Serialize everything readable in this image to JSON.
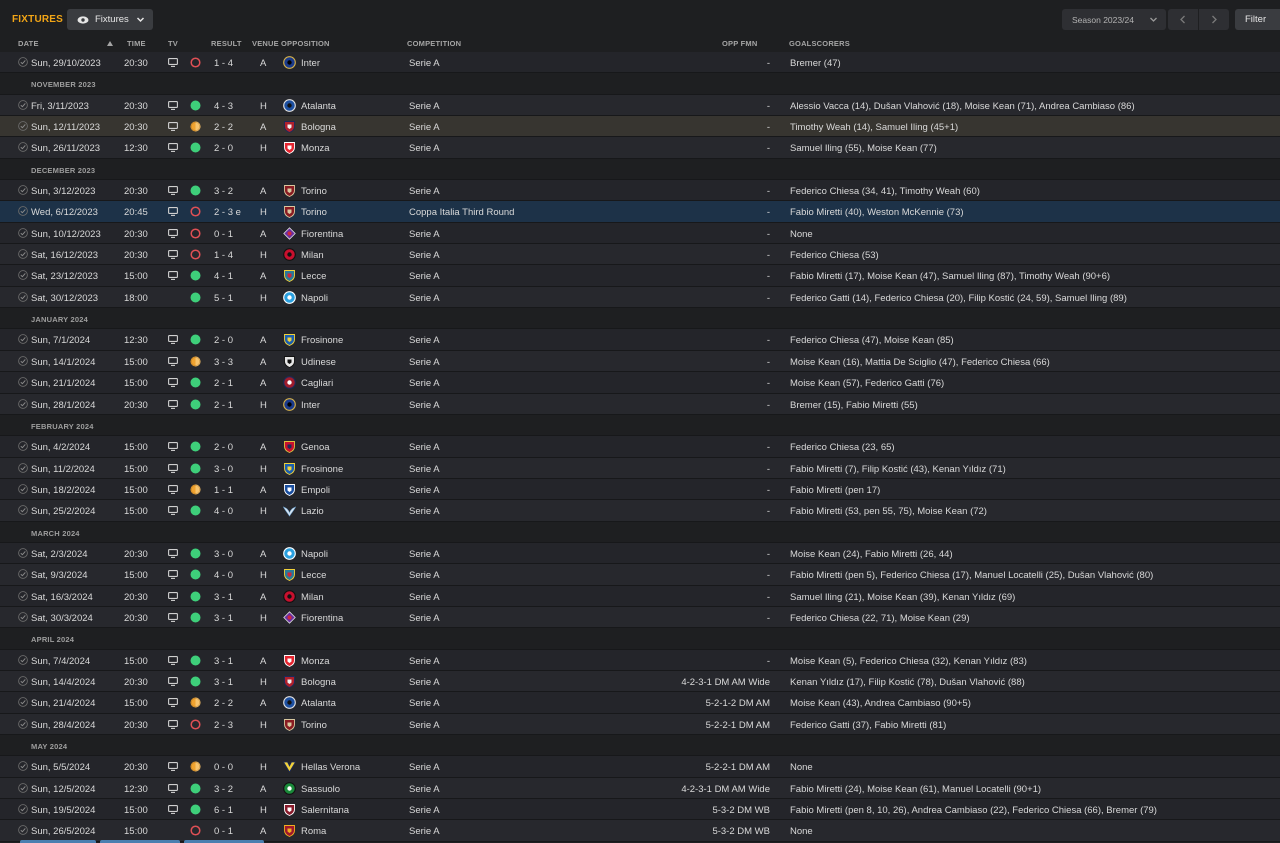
{
  "header": {
    "title": "FIXTURES",
    "view_label": "Fixtures",
    "season_label": "Season 2023/24",
    "filter_label": "Filter"
  },
  "columns": {
    "date": "DATE",
    "time": "TIME",
    "tv": "TV",
    "result": "RESULT",
    "venue": "VENUE",
    "opposition": "OPPOSITION",
    "competition": "COMPETITION",
    "opp_fmn": "OPP FMN",
    "goalscorers": "GOALSCORERS"
  },
  "colors": {
    "win": "#3ecf7a",
    "draw": "#f0a330",
    "loss": "#e05055",
    "accent": "#f2a516"
  },
  "rows": [
    {
      "type": "match",
      "date": "Sun, 29/10/2023",
      "time": "20:30",
      "tv": true,
      "outcome": "loss",
      "score": "1 - 4",
      "venue": "A",
      "opp": "Inter",
      "crest": "inter",
      "comp": "Serie A",
      "fmn": "-",
      "scorers": "Bremer (47)"
    },
    {
      "type": "section",
      "label": "NOVEMBER 2023"
    },
    {
      "type": "match",
      "date": "Fri, 3/11/2023",
      "time": "20:30",
      "tv": true,
      "outcome": "win",
      "score": "4 - 3",
      "venue": "H",
      "opp": "Atalanta",
      "crest": "atalanta",
      "comp": "Serie A",
      "fmn": "-",
      "scorers": "Alessio Vacca (14), Dušan Vlahović (18), Moise Kean (71), Andrea Cambiaso (86)"
    },
    {
      "type": "match",
      "date": "Sun, 12/11/2023",
      "time": "20:30",
      "tv": true,
      "outcome": "draw",
      "score": "2 - 2",
      "venue": "A",
      "opp": "Bologna",
      "crest": "bologna",
      "comp": "Serie A",
      "fmn": "-",
      "scorers": "Timothy Weah (14), Samuel Iling (45+1)",
      "state": "highlight"
    },
    {
      "type": "match",
      "date": "Sun, 26/11/2023",
      "time": "12:30",
      "tv": true,
      "outcome": "win",
      "score": "2 - 0",
      "venue": "H",
      "opp": "Monza",
      "crest": "monza",
      "comp": "Serie A",
      "fmn": "-",
      "scorers": "Samuel Iling (55), Moise Kean (77)"
    },
    {
      "type": "section",
      "label": "DECEMBER 2023"
    },
    {
      "type": "match",
      "date": "Sun, 3/12/2023",
      "time": "20:30",
      "tv": true,
      "outcome": "win",
      "score": "3 - 2",
      "venue": "A",
      "opp": "Torino",
      "crest": "torino",
      "comp": "Serie A",
      "fmn": "-",
      "scorers": "Federico Chiesa (34, 41), Timothy Weah (60)"
    },
    {
      "type": "match",
      "date": "Wed, 6/12/2023",
      "time": "20:45",
      "tv": true,
      "outcome": "loss",
      "score": "2 - 3 e",
      "venue": "H",
      "opp": "Torino",
      "crest": "torino",
      "comp": "Coppa Italia Third Round",
      "fmn": "-",
      "scorers": "Fabio Miretti (40), Weston McKennie (73)",
      "state": "selected"
    },
    {
      "type": "match",
      "date": "Sun, 10/12/2023",
      "time": "20:30",
      "tv": true,
      "outcome": "loss",
      "score": "0 - 1",
      "venue": "A",
      "opp": "Fiorentina",
      "crest": "fiorentina",
      "comp": "Serie A",
      "fmn": "-",
      "scorers": "None"
    },
    {
      "type": "match",
      "date": "Sat, 16/12/2023",
      "time": "20:30",
      "tv": true,
      "outcome": "loss",
      "score": "1 - 4",
      "venue": "H",
      "opp": "Milan",
      "crest": "milan",
      "comp": "Serie A",
      "fmn": "-",
      "scorers": "Federico Chiesa (53)"
    },
    {
      "type": "match",
      "date": "Sat, 23/12/2023",
      "time": "15:00",
      "tv": true,
      "outcome": "win",
      "score": "4 - 1",
      "venue": "A",
      "opp": "Lecce",
      "crest": "lecce",
      "comp": "Serie A",
      "fmn": "-",
      "scorers": "Fabio Miretti (17), Moise Kean (47), Samuel Iling (87), Timothy Weah (90+6)"
    },
    {
      "type": "match",
      "date": "Sat, 30/12/2023",
      "time": "18:00",
      "tv": false,
      "outcome": "win",
      "score": "5 - 1",
      "venue": "H",
      "opp": "Napoli",
      "crest": "napoli",
      "comp": "Serie A",
      "fmn": "-",
      "scorers": "Federico Gatti (14), Federico Chiesa (20), Filip Kostić (24, 59), Samuel Iling (89)"
    },
    {
      "type": "section",
      "label": "JANUARY 2024"
    },
    {
      "type": "match",
      "date": "Sun, 7/1/2024",
      "time": "12:30",
      "tv": true,
      "outcome": "win",
      "score": "2 - 0",
      "venue": "A",
      "opp": "Frosinone",
      "crest": "frosinone",
      "comp": "Serie A",
      "fmn": "-",
      "scorers": "Federico Chiesa (47), Moise Kean (85)"
    },
    {
      "type": "match",
      "date": "Sun, 14/1/2024",
      "time": "15:00",
      "tv": true,
      "outcome": "draw",
      "score": "3 - 3",
      "venue": "A",
      "opp": "Udinese",
      "crest": "udinese",
      "comp": "Serie A",
      "fmn": "-",
      "scorers": "Moise Kean (16), Mattia De Sciglio (47), Federico Chiesa (66)"
    },
    {
      "type": "match",
      "date": "Sun, 21/1/2024",
      "time": "15:00",
      "tv": true,
      "outcome": "win",
      "score": "2 - 1",
      "venue": "A",
      "opp": "Cagliari",
      "crest": "cagliari",
      "comp": "Serie A",
      "fmn": "-",
      "scorers": "Moise Kean (57), Federico Gatti (76)"
    },
    {
      "type": "match",
      "date": "Sun, 28/1/2024",
      "time": "20:30",
      "tv": true,
      "outcome": "win",
      "score": "2 - 1",
      "venue": "H",
      "opp": "Inter",
      "crest": "inter",
      "comp": "Serie A",
      "fmn": "-",
      "scorers": "Bremer (15), Fabio Miretti (55)"
    },
    {
      "type": "section",
      "label": "FEBRUARY 2024"
    },
    {
      "type": "match",
      "date": "Sun, 4/2/2024",
      "time": "15:00",
      "tv": true,
      "outcome": "win",
      "score": "2 - 0",
      "venue": "A",
      "opp": "Genoa",
      "crest": "genoa",
      "comp": "Serie A",
      "fmn": "-",
      "scorers": "Federico Chiesa (23, 65)"
    },
    {
      "type": "match",
      "date": "Sun, 11/2/2024",
      "time": "15:00",
      "tv": true,
      "outcome": "win",
      "score": "3 - 0",
      "venue": "H",
      "opp": "Frosinone",
      "crest": "frosinone",
      "comp": "Serie A",
      "fmn": "-",
      "scorers": "Fabio Miretti (7), Filip Kostić (43), Kenan Yıldız (71)"
    },
    {
      "type": "match",
      "date": "Sun, 18/2/2024",
      "time": "15:00",
      "tv": true,
      "outcome": "draw",
      "score": "1 - 1",
      "venue": "A",
      "opp": "Empoli",
      "crest": "empoli",
      "comp": "Serie A",
      "fmn": "-",
      "scorers": "Fabio Miretti (pen 17)"
    },
    {
      "type": "match",
      "date": "Sun, 25/2/2024",
      "time": "15:00",
      "tv": true,
      "outcome": "win",
      "score": "4 - 0",
      "venue": "H",
      "opp": "Lazio",
      "crest": "lazio",
      "comp": "Serie A",
      "fmn": "-",
      "scorers": "Fabio Miretti (53, pen 55, 75), Moise Kean (72)"
    },
    {
      "type": "section",
      "label": "MARCH 2024"
    },
    {
      "type": "match",
      "date": "Sat, 2/3/2024",
      "time": "20:30",
      "tv": true,
      "outcome": "win",
      "score": "3 - 0",
      "venue": "A",
      "opp": "Napoli",
      "crest": "napoli",
      "comp": "Serie A",
      "fmn": "-",
      "scorers": "Moise Kean (24), Fabio Miretti (26, 44)"
    },
    {
      "type": "match",
      "date": "Sat, 9/3/2024",
      "time": "15:00",
      "tv": true,
      "outcome": "win",
      "score": "4 - 0",
      "venue": "H",
      "opp": "Lecce",
      "crest": "lecce",
      "comp": "Serie A",
      "fmn": "-",
      "scorers": "Fabio Miretti (pen 5), Federico Chiesa (17), Manuel Locatelli (25), Dušan Vlahović (80)"
    },
    {
      "type": "match",
      "date": "Sat, 16/3/2024",
      "time": "20:30",
      "tv": true,
      "outcome": "win",
      "score": "3 - 1",
      "venue": "A",
      "opp": "Milan",
      "crest": "milan",
      "comp": "Serie A",
      "fmn": "-",
      "scorers": "Samuel Iling (21), Moise Kean (39), Kenan Yıldız (69)"
    },
    {
      "type": "match",
      "date": "Sat, 30/3/2024",
      "time": "20:30",
      "tv": true,
      "outcome": "win",
      "score": "3 - 1",
      "venue": "H",
      "opp": "Fiorentina",
      "crest": "fiorentina",
      "comp": "Serie A",
      "fmn": "-",
      "scorers": "Federico Chiesa (22, 71), Moise Kean (29)"
    },
    {
      "type": "section",
      "label": "APRIL 2024"
    },
    {
      "type": "match",
      "date": "Sun, 7/4/2024",
      "time": "15:00",
      "tv": true,
      "outcome": "win",
      "score": "3 - 1",
      "venue": "A",
      "opp": "Monza",
      "crest": "monza",
      "comp": "Serie A",
      "fmn": "-",
      "scorers": "Moise Kean (5), Federico Chiesa (32), Kenan Yıldız (83)"
    },
    {
      "type": "match",
      "date": "Sun, 14/4/2024",
      "time": "20:30",
      "tv": true,
      "outcome": "win",
      "score": "3 - 1",
      "venue": "H",
      "opp": "Bologna",
      "crest": "bologna",
      "comp": "Serie A",
      "fmn": "4-2-3-1 DM AM Wide",
      "scorers": "Kenan Yıldız (17), Filip Kostić (78), Dušan Vlahović (88)"
    },
    {
      "type": "match",
      "date": "Sun, 21/4/2024",
      "time": "15:00",
      "tv": true,
      "outcome": "draw",
      "score": "2 - 2",
      "venue": "A",
      "opp": "Atalanta",
      "crest": "atalanta",
      "comp": "Serie A",
      "fmn": "5-2-1-2 DM AM",
      "scorers": "Moise Kean (43), Andrea Cambiaso (90+5)"
    },
    {
      "type": "match",
      "date": "Sun, 28/4/2024",
      "time": "20:30",
      "tv": true,
      "outcome": "loss",
      "score": "2 - 3",
      "venue": "H",
      "opp": "Torino",
      "crest": "torino",
      "comp": "Serie A",
      "fmn": "5-2-2-1 DM AM",
      "scorers": "Federico Gatti (37), Fabio Miretti (81)"
    },
    {
      "type": "section",
      "label": "MAY 2024"
    },
    {
      "type": "match",
      "date": "Sun, 5/5/2024",
      "time": "20:30",
      "tv": true,
      "outcome": "draw",
      "score": "0 - 0",
      "venue": "H",
      "opp": "Hellas Verona",
      "crest": "verona",
      "comp": "Serie A",
      "fmn": "5-2-2-1 DM AM",
      "scorers": "None"
    },
    {
      "type": "match",
      "date": "Sun, 12/5/2024",
      "time": "12:30",
      "tv": true,
      "outcome": "win",
      "score": "3 - 2",
      "venue": "A",
      "opp": "Sassuolo",
      "crest": "sassuolo",
      "comp": "Serie A",
      "fmn": "4-2-3-1 DM AM Wide",
      "scorers": "Fabio Miretti (24), Moise Kean (61), Manuel Locatelli (90+1)"
    },
    {
      "type": "match",
      "date": "Sun, 19/5/2024",
      "time": "15:00",
      "tv": true,
      "outcome": "win",
      "score": "6 - 1",
      "venue": "H",
      "opp": "Salernitana",
      "crest": "salernitana",
      "comp": "Serie A",
      "fmn": "5-3-2 DM WB",
      "scorers": "Fabio Miretti (pen 8, 10, 26), Andrea Cambiaso (22), Federico Chiesa (66), Bremer (79)"
    },
    {
      "type": "match",
      "date": "Sun, 26/5/2024",
      "time": "15:00",
      "tv": false,
      "outcome": "loss",
      "score": "0 - 1",
      "venue": "A",
      "opp": "Roma",
      "crest": "roma",
      "comp": "Serie A",
      "fmn": "5-3-2 DM WB",
      "scorers": "None"
    }
  ]
}
